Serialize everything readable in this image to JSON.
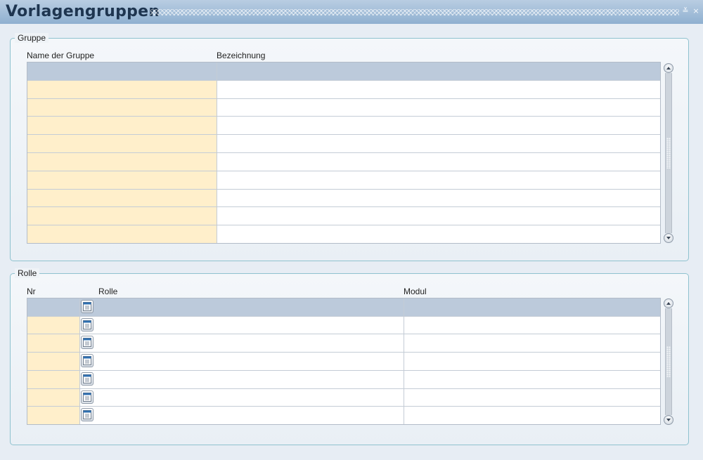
{
  "window": {
    "title": "Vorlagengruppen",
    "minimize_glyph": "≚",
    "close_glyph": "×"
  },
  "gruppe": {
    "legend": "Gruppe",
    "columns": [
      "Name der Gruppe",
      "Bezeichnung"
    ],
    "rows": [
      {
        "name": "",
        "bezeichnung": ""
      },
      {
        "name": "",
        "bezeichnung": ""
      },
      {
        "name": "",
        "bezeichnung": ""
      },
      {
        "name": "",
        "bezeichnung": ""
      },
      {
        "name": "",
        "bezeichnung": ""
      },
      {
        "name": "",
        "bezeichnung": ""
      },
      {
        "name": "",
        "bezeichnung": ""
      },
      {
        "name": "",
        "bezeichnung": ""
      },
      {
        "name": "",
        "bezeichnung": ""
      },
      {
        "name": "",
        "bezeichnung": ""
      }
    ]
  },
  "rolle": {
    "legend": "Rolle",
    "columns": [
      "Nr",
      "Rolle",
      "Modul"
    ],
    "rows": [
      {
        "nr": "",
        "rolle": "",
        "modul": ""
      },
      {
        "nr": "",
        "rolle": "",
        "modul": ""
      },
      {
        "nr": "",
        "rolle": "",
        "modul": ""
      },
      {
        "nr": "",
        "rolle": "",
        "modul": ""
      },
      {
        "nr": "",
        "rolle": "",
        "modul": ""
      },
      {
        "nr": "",
        "rolle": "",
        "modul": ""
      },
      {
        "nr": "",
        "rolle": "",
        "modul": ""
      }
    ]
  },
  "icons": {
    "lov": "list-of-values-icon",
    "scroll_up": "chevron-up-icon",
    "scroll_down": "chevron-down-icon"
  },
  "colors": {
    "titlebar": "#8fb0d0",
    "key_cell": "#ffefcb",
    "current_row": "#bccadb",
    "groupbox_border": "#8fc2cf"
  }
}
